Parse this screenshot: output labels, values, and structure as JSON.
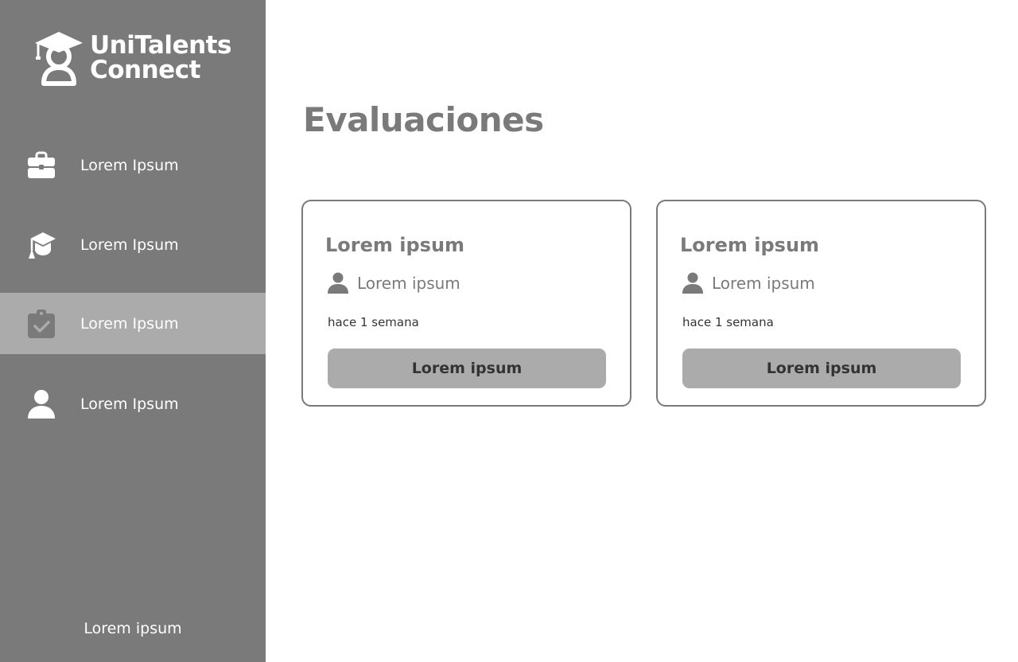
{
  "colors": {
    "sidebar_bg": "#7a7a7a",
    "sidebar_active_bg": "#ababab",
    "text_white": "#ffffff",
    "title_gray": "#7a7a7a",
    "button_bg": "#ababab",
    "button_text": "#333333"
  },
  "sidebar": {
    "logo": {
      "line1": "UniTalents",
      "line2": "Connect",
      "icon": "graduate-person-logo-icon"
    },
    "items": [
      {
        "label": "Lorem Ipsum",
        "icon": "briefcase-icon",
        "active": false
      },
      {
        "label": "Lorem Ipsum",
        "icon": "graduation-cap-icon",
        "active": false
      },
      {
        "label": "Lorem Ipsum",
        "icon": "clipboard-check-icon",
        "active": true
      },
      {
        "label": "Lorem Ipsum",
        "icon": "person-icon",
        "active": false
      }
    ],
    "footer_label": "Lorem ipsum"
  },
  "main": {
    "title": "Evaluaciones",
    "cards": [
      {
        "title": "Lorem ipsum",
        "user": "Lorem ipsum",
        "time": "hace 1 semana",
        "button": "Lorem ipsum",
        "user_icon": "person-icon"
      },
      {
        "title": "Lorem ipsum",
        "user": "Lorem ipsum",
        "time": "hace 1 semana",
        "button": "Lorem ipsum",
        "user_icon": "person-icon"
      }
    ]
  }
}
